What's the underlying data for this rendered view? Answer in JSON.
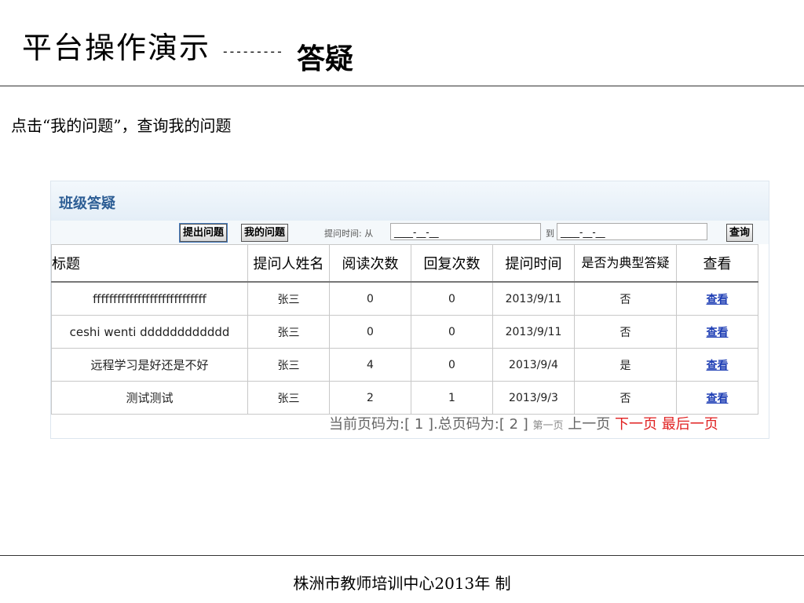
{
  "slide": {
    "title": "平台操作演示",
    "dashes": "---------",
    "subtitle": "答疑",
    "instruction": "点击“我的问题”，查询我的问题",
    "footer": "株洲市教师培训中心2013年 制"
  },
  "panel": {
    "title": "班级答疑",
    "toolbar": {
      "ask_label": "提出问题",
      "mine_label": "我的问题",
      "time_label": "提问时间: 从",
      "date_from": "____-__-__",
      "to_label": "到",
      "date_to": "____-__-__",
      "query_label": "查询"
    },
    "table": {
      "headers": [
        "标题",
        "提问人姓名",
        "阅读次数",
        "回复次数",
        "提问时间",
        "是否为典型答疑",
        "查看"
      ],
      "rows": [
        {
          "title": "ffffffffffffffffffffffffffff",
          "asker": "张三",
          "reads": "0",
          "replies": "0",
          "time": "2013/9/11",
          "typical": "否",
          "view": "查看"
        },
        {
          "title": "ceshi wenti dddddddddddd",
          "asker": "张三",
          "reads": "0",
          "replies": "0",
          "time": "2013/9/11",
          "typical": "否",
          "view": "查看"
        },
        {
          "title": "远程学习是好还是不好",
          "asker": "张三",
          "reads": "4",
          "replies": "0",
          "time": "2013/9/4",
          "typical": "是",
          "view": "查看"
        },
        {
          "title": "测试测试",
          "asker": "张三",
          "reads": "2",
          "replies": "1",
          "time": "2013/9/3",
          "typical": "否",
          "view": "查看"
        }
      ]
    },
    "pager": {
      "current_label": "当前页码为:",
      "current": "[ 1 ]",
      "total_label": ".总页码为:",
      "total": "[ 2 ]",
      "first": "第一页",
      "prev": "上一页",
      "next": "下一页",
      "last": "最后一页"
    },
    "colors": {
      "link": "#1f3fb5",
      "pager_active": "#e02020",
      "title": "#2c5d94"
    }
  }
}
